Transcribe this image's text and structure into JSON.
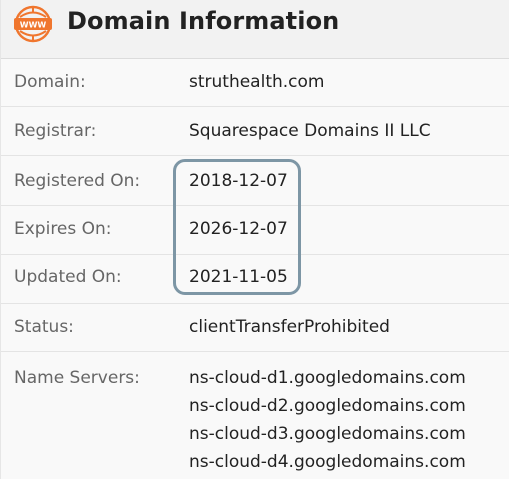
{
  "header": {
    "icon_text": "WWW",
    "title": "Domain Information"
  },
  "rows": [
    {
      "label": "Domain:",
      "value": "struthealth.com"
    },
    {
      "label": "Registrar:",
      "value": "Squarespace Domains II LLC"
    },
    {
      "label": "Registered On:",
      "value": "2018-12-07"
    },
    {
      "label": "Expires On:",
      "value": "2026-12-07"
    },
    {
      "label": "Updated On:",
      "value": "2021-11-05"
    },
    {
      "label": "Status:",
      "value": "clientTransferProhibited"
    }
  ],
  "name_servers": {
    "label": "Name Servers:",
    "items": [
      "ns-cloud-d1.googledomains.com",
      "ns-cloud-d2.googledomains.com",
      "ns-cloud-d3.googledomains.com",
      "ns-cloud-d4.googledomains.com"
    ]
  },
  "colors": {
    "icon_accent": "#f0762e",
    "highlight_border": "#7d96a5"
  }
}
